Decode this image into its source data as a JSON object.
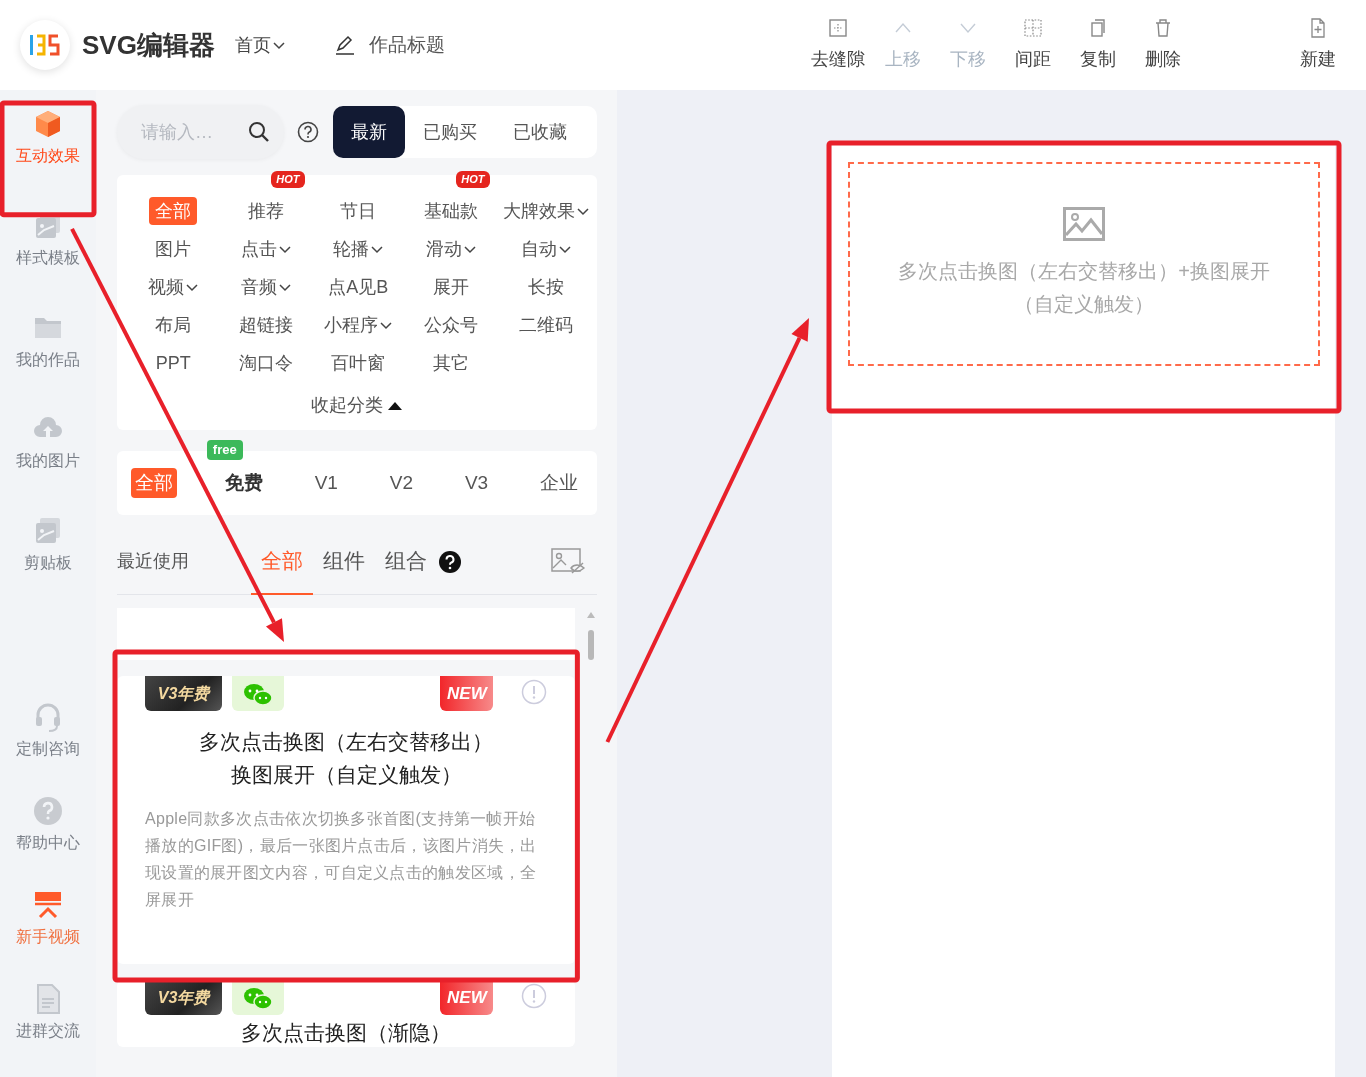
{
  "header": {
    "logo_text": "SVG编辑器",
    "nav": "首页",
    "title": "作品标题"
  },
  "toolbar": [
    {
      "label": "去缝隙",
      "kind": "gapless",
      "disabled": false
    },
    {
      "label": "上移",
      "kind": "up",
      "disabled": true
    },
    {
      "label": "下移",
      "kind": "down",
      "disabled": true
    },
    {
      "label": "间距",
      "kind": "spacing",
      "disabled": false
    },
    {
      "label": "复制",
      "kind": "copy",
      "disabled": false
    },
    {
      "label": "删除",
      "kind": "delete",
      "disabled": false
    },
    {
      "label": "新建",
      "kind": "new",
      "disabled": false
    }
  ],
  "sidebar": {
    "items": [
      {
        "label": "互动效果",
        "kind": "cube",
        "selected": true,
        "accent": false,
        "annotated": true
      },
      {
        "label": "样式模板",
        "kind": "template",
        "selected": false,
        "accent": false,
        "annotated": false
      },
      {
        "label": "我的作品",
        "kind": "folder",
        "selected": false,
        "accent": false,
        "annotated": false
      },
      {
        "label": "我的图片",
        "kind": "cloud",
        "selected": false,
        "accent": false,
        "annotated": false
      },
      {
        "label": "剪贴板",
        "kind": "template",
        "selected": false,
        "accent": false,
        "annotated": false
      },
      {
        "label": "定制咨询",
        "kind": "headset",
        "selected": false,
        "accent": false,
        "annotated": false
      },
      {
        "label": "帮助中心",
        "kind": "help",
        "selected": false,
        "accent": false,
        "annotated": false
      },
      {
        "label": "新手视频",
        "kind": "video",
        "selected": false,
        "accent": true,
        "annotated": false
      },
      {
        "label": "进群交流",
        "kind": "document",
        "selected": false,
        "accent": false,
        "annotated": false
      }
    ]
  },
  "search": {
    "placeholder": "请输入…"
  },
  "source_tabs": [
    {
      "label": "最新",
      "selected": true
    },
    {
      "label": "已购买",
      "selected": false
    },
    {
      "label": "已收藏",
      "selected": false
    }
  ],
  "categories": {
    "items": [
      {
        "label": "全部",
        "selected": true,
        "dropdown": false,
        "hot": false
      },
      {
        "label": "推荐",
        "selected": false,
        "dropdown": false,
        "hot": "HOT"
      },
      {
        "label": "节日",
        "selected": false,
        "dropdown": false,
        "hot": false
      },
      {
        "label": "基础款",
        "selected": false,
        "dropdown": false,
        "hot": "HOT"
      },
      {
        "label": "大牌效果",
        "selected": false,
        "dropdown": true,
        "hot": false
      },
      {
        "label": "图片",
        "selected": false,
        "dropdown": false,
        "hot": false
      },
      {
        "label": "点击",
        "selected": false,
        "dropdown": true,
        "hot": false
      },
      {
        "label": "轮播",
        "selected": false,
        "dropdown": true,
        "hot": false
      },
      {
        "label": "滑动",
        "selected": false,
        "dropdown": true,
        "hot": false
      },
      {
        "label": "自动",
        "selected": false,
        "dropdown": true,
        "hot": false
      },
      {
        "label": "视频",
        "selected": false,
        "dropdown": true,
        "hot": false
      },
      {
        "label": "音频",
        "selected": false,
        "dropdown": true,
        "hot": false
      },
      {
        "label": "点A见B",
        "selected": false,
        "dropdown": false,
        "hot": false
      },
      {
        "label": "展开",
        "selected": false,
        "dropdown": false,
        "hot": false
      },
      {
        "label": "长按",
        "selected": false,
        "dropdown": false,
        "hot": false
      },
      {
        "label": "布局",
        "selected": false,
        "dropdown": false,
        "hot": false
      },
      {
        "label": "超链接",
        "selected": false,
        "dropdown": false,
        "hot": false
      },
      {
        "label": "小程序",
        "selected": false,
        "dropdown": true,
        "hot": false
      },
      {
        "label": "公众号",
        "selected": false,
        "dropdown": false,
        "hot": false
      },
      {
        "label": "二维码",
        "selected": false,
        "dropdown": false,
        "hot": false
      },
      {
        "label": "PPT",
        "selected": false,
        "dropdown": false,
        "hot": false
      },
      {
        "label": "淘口令",
        "selected": false,
        "dropdown": false,
        "hot": false
      },
      {
        "label": "百叶窗",
        "selected": false,
        "dropdown": false,
        "hot": false
      },
      {
        "label": "其它",
        "selected": false,
        "dropdown": false,
        "hot": false
      }
    ],
    "collapse": "收起分类"
  },
  "tiers": [
    {
      "label": "全部",
      "selected": true
    },
    {
      "label": "免费",
      "selected": false,
      "tag": "free"
    },
    {
      "label": "V1",
      "selected": false
    },
    {
      "label": "V2",
      "selected": false
    },
    {
      "label": "V3",
      "selected": false
    },
    {
      "label": "企业",
      "selected": false
    }
  ],
  "library": {
    "recent": "最近使用",
    "tabs": [
      {
        "label": "全部",
        "selected": true
      },
      {
        "label": "组件",
        "selected": false
      },
      {
        "label": "组合",
        "selected": false
      }
    ]
  },
  "cards": [
    {
      "tier_badge": "V3年费",
      "new_badge": "NEW",
      "title_lines": [
        "多次点击换图（左右交替移出）",
        "换图展开（自定义触发）"
      ],
      "description": "Apple同款多次点击依次切换多张首图(支持第一帧开始播放的GIF图)，最后一张图片点击后，该图片消失，出现设置的展开图文内容，可自定义点击的触发区域，全屏展开",
      "annotated": true
    },
    {
      "tier_badge": "V3年费",
      "new_badge": "NEW",
      "title_lines": [
        "多次点击换图（渐隐）"
      ],
      "annotated": false
    }
  ],
  "canvas": {
    "block_text": "多次点击换图（左右交替移出）+换图展开（自定义触发）",
    "annotated": true
  }
}
